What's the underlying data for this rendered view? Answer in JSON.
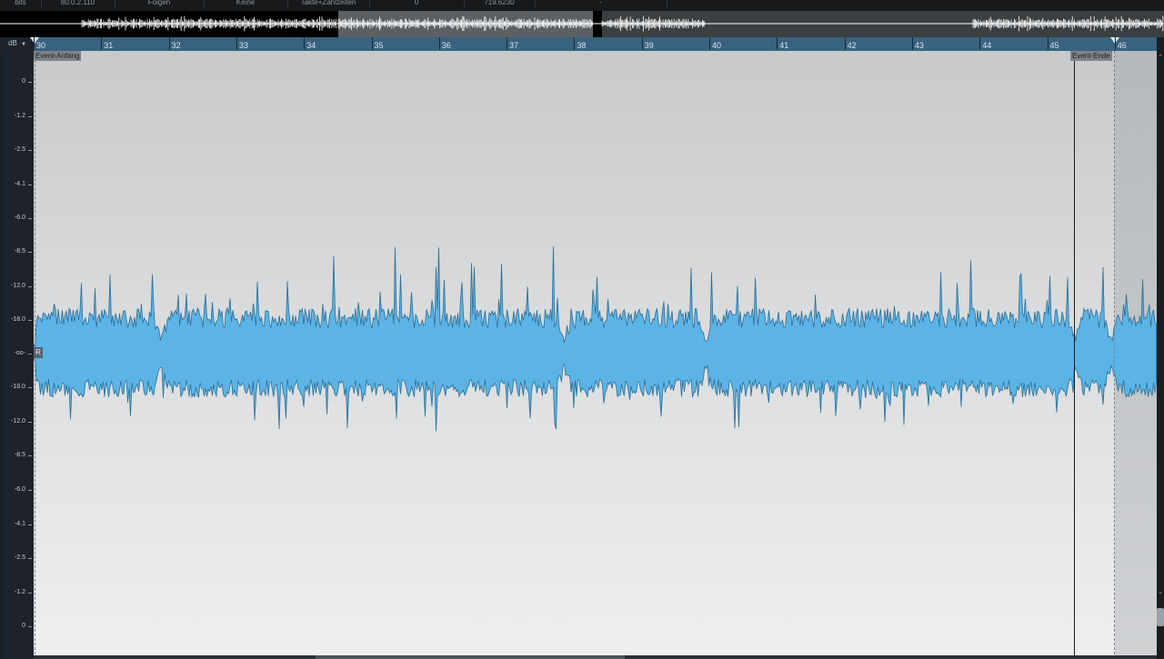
{
  "info_bar": [
    {
      "id": "bits",
      "text": "bits"
    },
    {
      "id": "position",
      "text": "80.0.2.110"
    },
    {
      "id": "follow",
      "text": "Folgen"
    },
    {
      "id": "snap",
      "text": "Keine"
    },
    {
      "id": "time_format",
      "text": "Takte+Zählzeiten"
    },
    {
      "id": "offset",
      "text": "0"
    },
    {
      "id": "tempo",
      "text": "719.6230"
    },
    {
      "id": "extra",
      "text": "-"
    }
  ],
  "db_unit": "dB",
  "db_ticks": [
    "0",
    "-1.2",
    "-2.5",
    "-4.1",
    "-6.0",
    "-8.5",
    "-12.0",
    "-18.0",
    "-oo-",
    "-18.0",
    "-12.0",
    "-8.5",
    "-6.0",
    "-4.1",
    "-2.5",
    "-1.2",
    "0"
  ],
  "ruler": {
    "bars": [
      "30",
      "31",
      "32",
      "33",
      "34",
      "35",
      "36",
      "37",
      "38",
      "39",
      "40",
      "41",
      "42",
      "43",
      "44",
      "45",
      "46"
    ]
  },
  "event_start_label": "Event-Anfang",
  "event_end_label": "Event-Ende",
  "channel_badge": "R",
  "colors": {
    "waveform_fill": "#5cb4e6",
    "waveform_outline": "#2a6e97",
    "ruler_bg": "#38627f",
    "overview_wave": "#ffffff"
  },
  "icons": {
    "scroll_up": "chevron-up-icon",
    "scroll_down": "chevron-down-icon",
    "db_menu": "caret-down-icon"
  }
}
